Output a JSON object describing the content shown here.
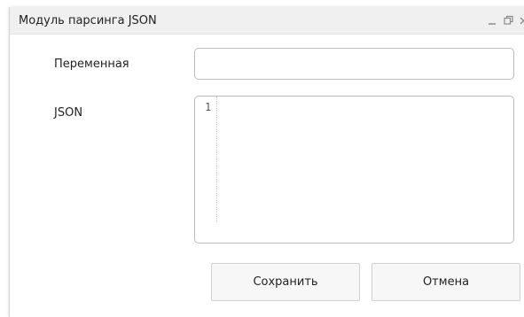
{
  "window": {
    "title": "Модуль парсинга JSON"
  },
  "form": {
    "variable_label": "Переменная",
    "variable_value": "",
    "json_label": "JSON",
    "editor_line_numbers": [
      "1"
    ],
    "editor_content": ""
  },
  "actions": {
    "save_label": "Сохранить",
    "cancel_label": "Отмена"
  },
  "icons": {
    "minimize": "minimize-icon",
    "maximize": "restore-icon",
    "close": "close-icon"
  },
  "colors": {
    "titlebar_bg": "#f0f0f0",
    "border": "#bcbcbc",
    "button_bg": "#f7f7f7"
  }
}
